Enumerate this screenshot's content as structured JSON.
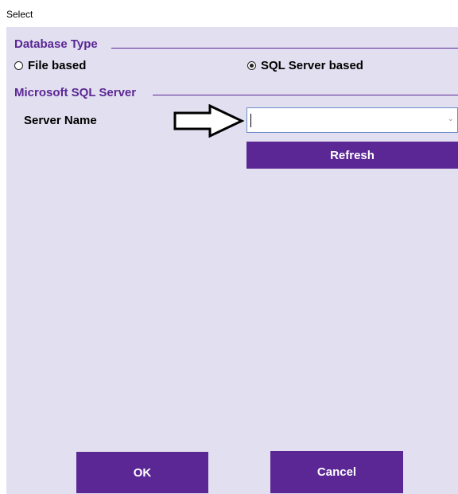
{
  "window": {
    "title": "Select"
  },
  "database_type": {
    "header": "Database Type",
    "options": [
      {
        "label": "File based",
        "selected": false
      },
      {
        "label": "SQL Server based",
        "selected": true
      }
    ]
  },
  "sql_server": {
    "header": "Microsoft SQL Server",
    "server_name_label": "Server Name",
    "server_name_value": "",
    "refresh_label": "Refresh"
  },
  "footer": {
    "ok_label": "OK",
    "cancel_label": "Cancel"
  },
  "colors": {
    "accent": "#5a2794",
    "panel": "#e2e0f0"
  },
  "icons": {
    "arrow": "right-arrow-icon",
    "dropdown": "chevron-down-icon"
  }
}
